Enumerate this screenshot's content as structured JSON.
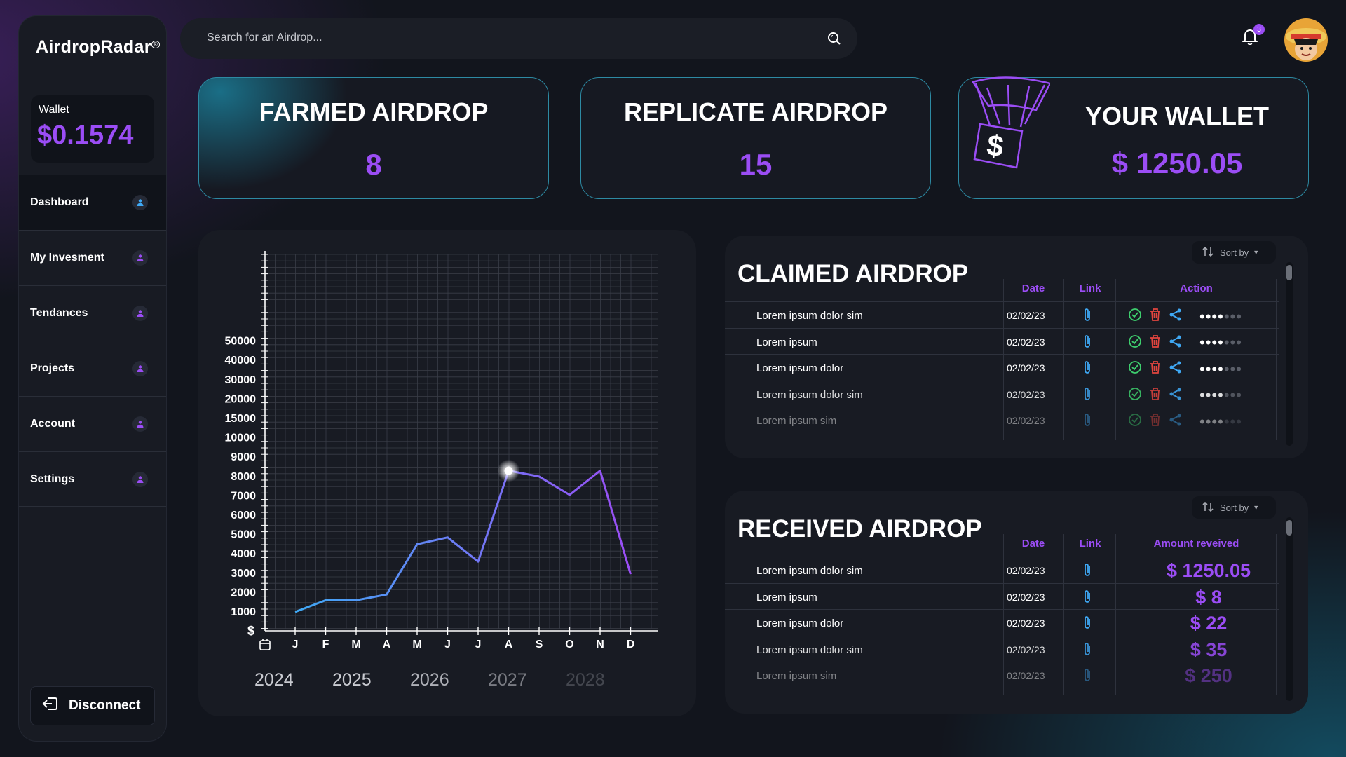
{
  "app": {
    "logo": "AirdropRadar"
  },
  "wallet": {
    "label": "Wallet",
    "value": "$0.1574"
  },
  "nav": [
    {
      "label": "Dashboard",
      "active": true
    },
    {
      "label": "My Invesment"
    },
    {
      "label": "Tendances"
    },
    {
      "label": "Projects"
    },
    {
      "label": "Account"
    },
    {
      "label": "Settings"
    }
  ],
  "disconnect_label": "Disconnect",
  "search": {
    "placeholder": "Search for an Airdrop..."
  },
  "notifications": {
    "count": "3"
  },
  "stats": {
    "farmed": {
      "title": "FARMED AIRDROP",
      "value": "8"
    },
    "replicate": {
      "title": "REPLICATE AIRDROP",
      "value": "15"
    },
    "wallet": {
      "title": "YOUR WALLET",
      "value": "$ 1250.05"
    }
  },
  "colors": {
    "accent": "#9b4df5",
    "teal": "#2d8aa3",
    "line_start": "#3fa9f5",
    "line_end": "#9b4df5"
  },
  "chart_data": {
    "type": "line",
    "ylabel": "$",
    "y_ticks": [
      "1000",
      "2000",
      "3000",
      "4000",
      "5000",
      "6000",
      "7000",
      "8000",
      "9000",
      "10000",
      "15000",
      "20000",
      "30000",
      "40000",
      "50000"
    ],
    "categories": [
      "J",
      "F",
      "M",
      "A",
      "M",
      "J",
      "J",
      "A",
      "S",
      "O",
      "N",
      "D"
    ],
    "series": [
      {
        "values": [
          1000,
          1600,
          1600,
          1900,
          4500,
          4850,
          3600,
          8300,
          8000,
          7050,
          8300,
          2950
        ]
      }
    ],
    "highlight_index": 7,
    "years": [
      "2024",
      "2025",
      "2026",
      "2027",
      "2028"
    ],
    "grid": true
  },
  "claimed": {
    "title": "CLAIMED AIRDROP",
    "sort_label": "Sort by",
    "headers": {
      "date": "Date",
      "link": "Link",
      "action": "Action"
    },
    "rows": [
      {
        "name": "Lorem ipsum dolor sim",
        "date": "02/02/23"
      },
      {
        "name": "Lorem ipsum",
        "date": "02/02/23"
      },
      {
        "name": "Lorem ipsum dolor",
        "date": "02/02/23"
      },
      {
        "name": "Lorem ipsum dolor sim",
        "date": "02/02/23"
      },
      {
        "name": "Lorem ipsum  sim",
        "date": "02/02/23"
      }
    ]
  },
  "received": {
    "title": "RECEIVED AIRDROP",
    "sort_label": "Sort by",
    "headers": {
      "date": "Date",
      "link": "Link",
      "amount": "Amount reveived"
    },
    "rows": [
      {
        "name": "Lorem ipsum dolor sim",
        "date": "02/02/23",
        "amount": "$ 1250.05"
      },
      {
        "name": "Lorem ipsum",
        "date": "02/02/23",
        "amount": "$ 8"
      },
      {
        "name": "Lorem ipsum dolor",
        "date": "02/02/23",
        "amount": "$ 22"
      },
      {
        "name": "Lorem ipsum dolor sim",
        "date": "02/02/23",
        "amount": "$ 35"
      },
      {
        "name": "Lorem ipsum  sim",
        "date": "02/02/23",
        "amount": "$ 250"
      }
    ]
  }
}
